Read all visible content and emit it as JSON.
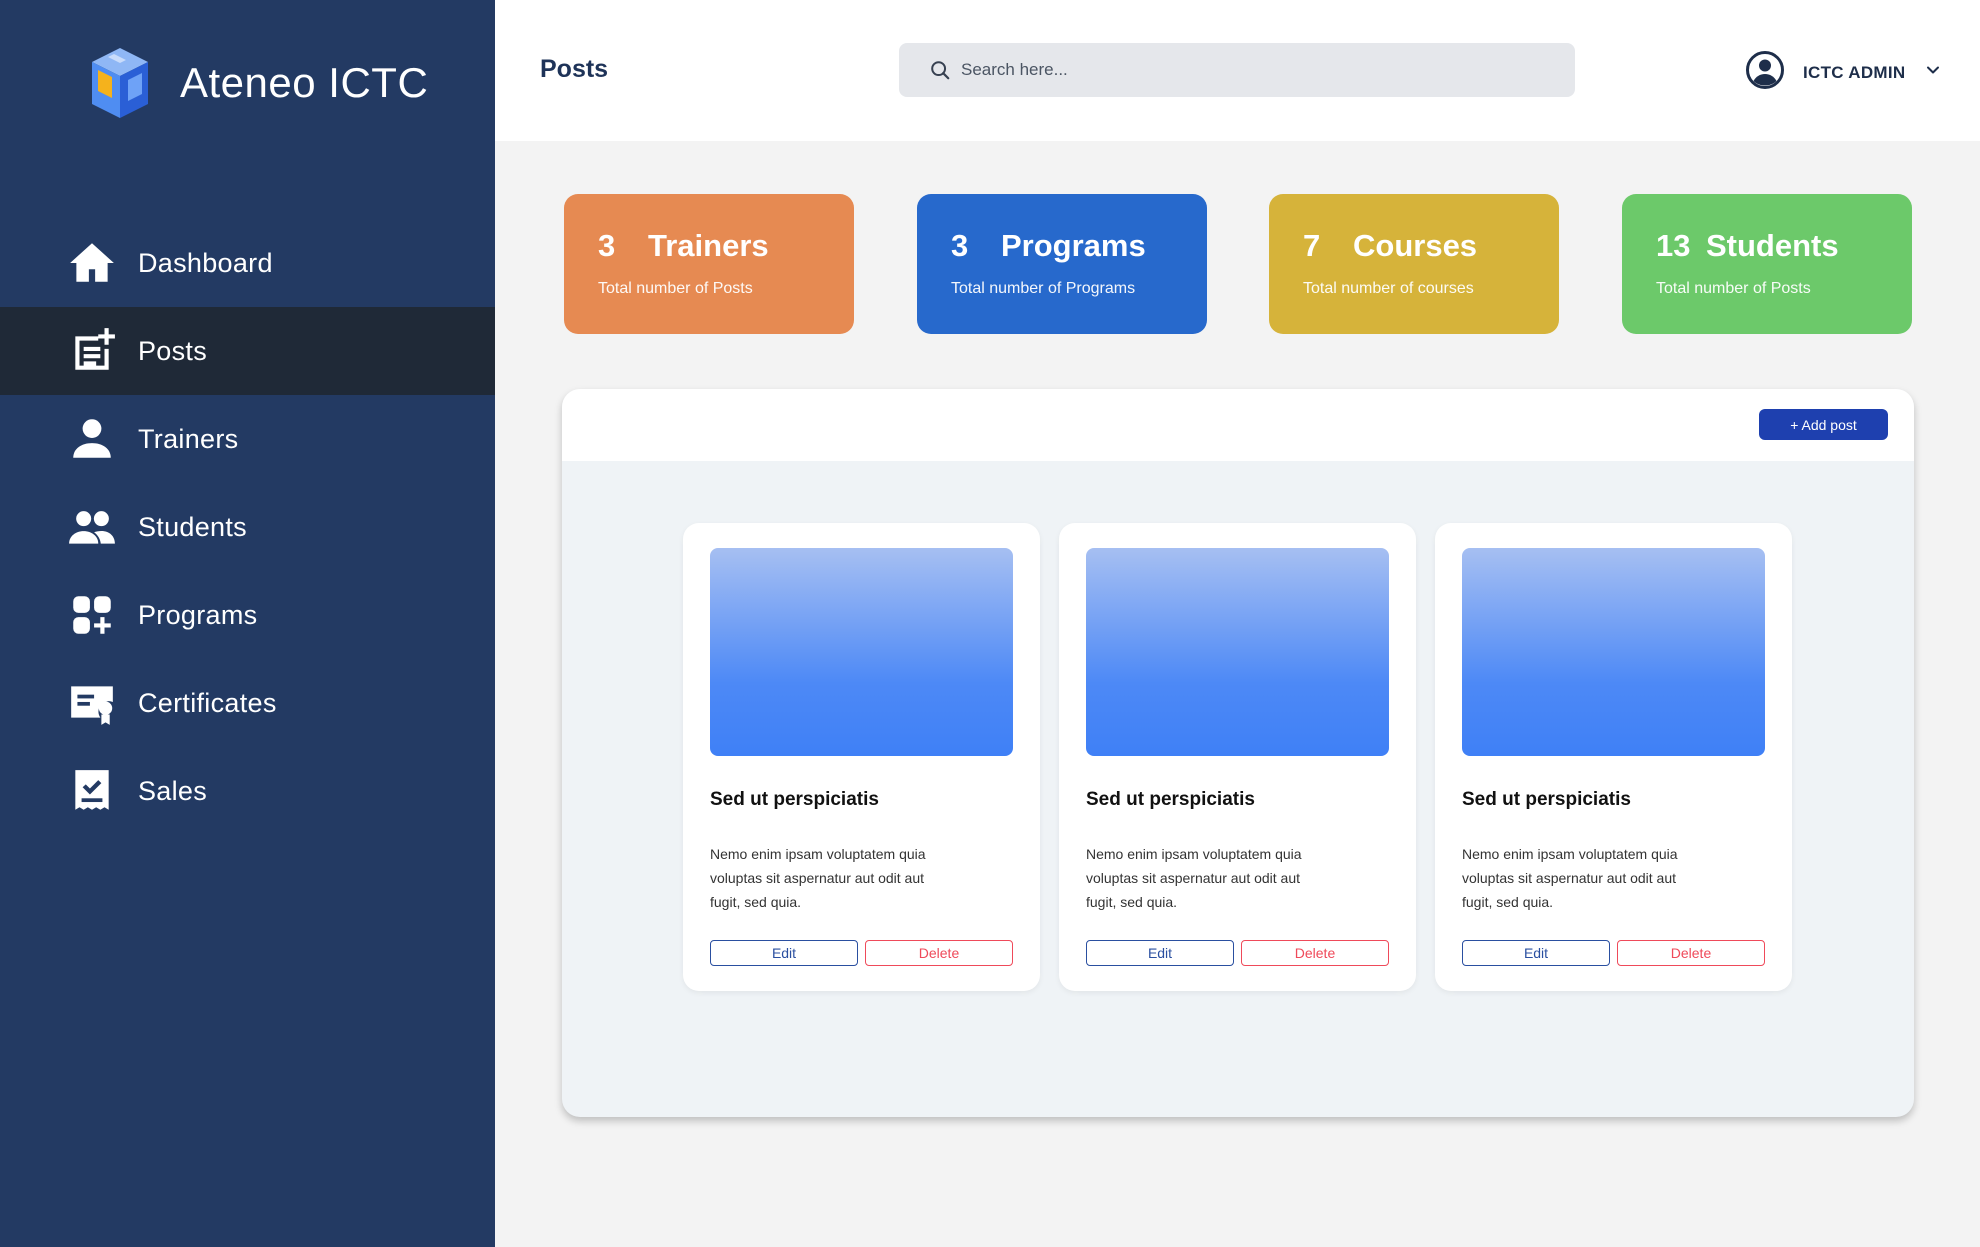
{
  "brand": {
    "name": "Ateneo ICTC"
  },
  "sidebar": {
    "items": [
      {
        "label": "Dashboard",
        "icon": "home-icon"
      },
      {
        "label": "Posts",
        "icon": "posts-icon",
        "active": true
      },
      {
        "label": "Trainers",
        "icon": "user-icon"
      },
      {
        "label": "Students",
        "icon": "users-icon"
      },
      {
        "label": "Programs",
        "icon": "apps-add-icon"
      },
      {
        "label": "Certificates",
        "icon": "certificate-icon"
      },
      {
        "label": "Sales",
        "icon": "receipt-check-icon"
      }
    ]
  },
  "header": {
    "title": "Posts",
    "search_placeholder": "Search here...",
    "user_name": "ICTC ADMIN"
  },
  "stats": [
    {
      "number": "3",
      "title": "Trainers",
      "subtitle": "Total number of Posts",
      "color": "#e68a52"
    },
    {
      "number": "3",
      "title": "Programs",
      "subtitle": "Total number of Programs",
      "color": "#2769cc"
    },
    {
      "number": "7",
      "title": "Courses",
      "subtitle": "Total number of courses",
      "color": "#d6b33a"
    },
    {
      "number": "13",
      "title": "Students",
      "subtitle": "Total number of Posts",
      "color": "#6cc96a"
    }
  ],
  "posts_panel": {
    "add_label": "+ Add post",
    "posts": [
      {
        "title": "Sed ut perspiciatis",
        "body": "Nemo enim ipsam voluptatem quia voluptas sit aspernatur aut odit aut fugit, sed quia.",
        "edit_label": "Edit",
        "delete_label": "Delete"
      },
      {
        "title": "Sed ut perspiciatis",
        "body": "Nemo enim ipsam voluptatem quia voluptas sit aspernatur aut odit aut fugit, sed quia.",
        "edit_label": "Edit",
        "delete_label": "Delete"
      },
      {
        "title": "Sed ut perspiciatis",
        "body": "Nemo enim ipsam voluptatem quia voluptas sit aspernatur aut odit aut fugit, sed quia.",
        "edit_label": "Edit",
        "delete_label": "Delete"
      }
    ]
  },
  "colors": {
    "sidebar_bg": "#233a63",
    "active_bg": "#1f2937",
    "accent": "#1e40af",
    "danger": "#ef4a5a"
  }
}
